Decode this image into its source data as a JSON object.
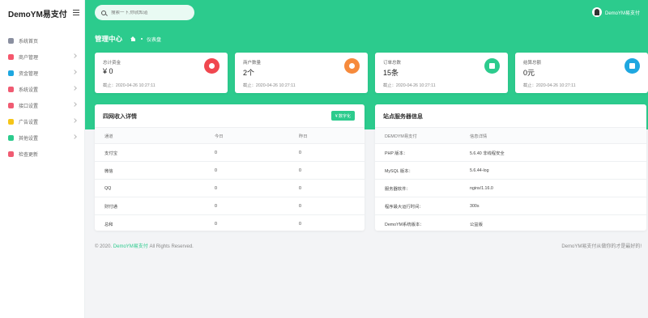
{
  "sidebar": {
    "brand": "DemoYM易支付",
    "items": [
      {
        "label": "系统首页",
        "icon": "dashboard-icon",
        "color": "#8a8fa0",
        "has_chevron": false
      },
      {
        "label": "商户管理",
        "icon": "users-icon",
        "color": "#f5576c",
        "has_chevron": true
      },
      {
        "label": "资金管理",
        "icon": "money-icon",
        "color": "#1ea7e0",
        "has_chevron": true
      },
      {
        "label": "系统设置",
        "icon": "settings-icon",
        "color": "#f05b72",
        "has_chevron": true
      },
      {
        "label": "接口设置",
        "icon": "plug-icon",
        "color": "#f05b72",
        "has_chevron": true
      },
      {
        "label": "广告设置",
        "icon": "ad-icon",
        "color": "#f5c518",
        "has_chevron": true
      },
      {
        "label": "其他设置",
        "icon": "gear-icon",
        "color": "#2ccb8d",
        "has_chevron": true
      },
      {
        "label": "检查更新",
        "icon": "update-icon",
        "color": "#f05b72",
        "has_chevron": false
      }
    ]
  },
  "topbar": {
    "search_placeholder": "搜索一下,你就知道",
    "username": "DemoYM易支付"
  },
  "header": {
    "title": "管理中心",
    "crumb": "仪表盘"
  },
  "stats": [
    {
      "label": "总计资金",
      "value": "¥ 0",
      "time": "截止：2020-04-26 10:27:11",
      "icon": "pie-chart-icon",
      "color": "#f0474f"
    },
    {
      "label": "商户数量",
      "value": "2个",
      "time": "截止：2020-04-26 10:27:11",
      "icon": "user-icon",
      "color": "#f68a3c"
    },
    {
      "label": "订单总数",
      "value": "15条",
      "time": "截止：2020-04-26 10:27:11",
      "icon": "cart-icon",
      "color": "#2ccb8d"
    },
    {
      "label": "结算总额",
      "value": "0元",
      "time": "截止：2020-04-26 10:27:11",
      "icon": "card-icon",
      "color": "#1ea7e0"
    }
  ],
  "income": {
    "title": "四网收入详情",
    "button": "¥ 数字化",
    "headers": [
      "通道",
      "今日",
      "昨日"
    ],
    "rows": [
      [
        "支付宝",
        "0",
        "0"
      ],
      [
        "微信",
        "0",
        "0"
      ],
      [
        "QQ",
        "0",
        "0"
      ],
      [
        "财付通",
        "0",
        "0"
      ],
      [
        "总和",
        "0",
        "0"
      ]
    ]
  },
  "server": {
    "title": "站点服务器信息",
    "headers": [
      "DEMOYM易支付",
      "信息详情"
    ],
    "rows": [
      [
        "PHP 版本：",
        "5.6.40 非线程安全"
      ],
      [
        "MySQL 版本：",
        "5.6.44-log"
      ],
      [
        "服务器软件：",
        "nginx/1.16.0"
      ],
      [
        "程序最大运行时间：",
        "300s"
      ],
      [
        "DemoYM系统版本：",
        "公益版"
      ]
    ]
  },
  "footer": {
    "copyright_prefix": "© 2020.",
    "brand": "DemoYM易支付",
    "copyright_suffix": "All Rights Reserved.",
    "right": "DemoYM易支付从做你的才是最好的!"
  }
}
